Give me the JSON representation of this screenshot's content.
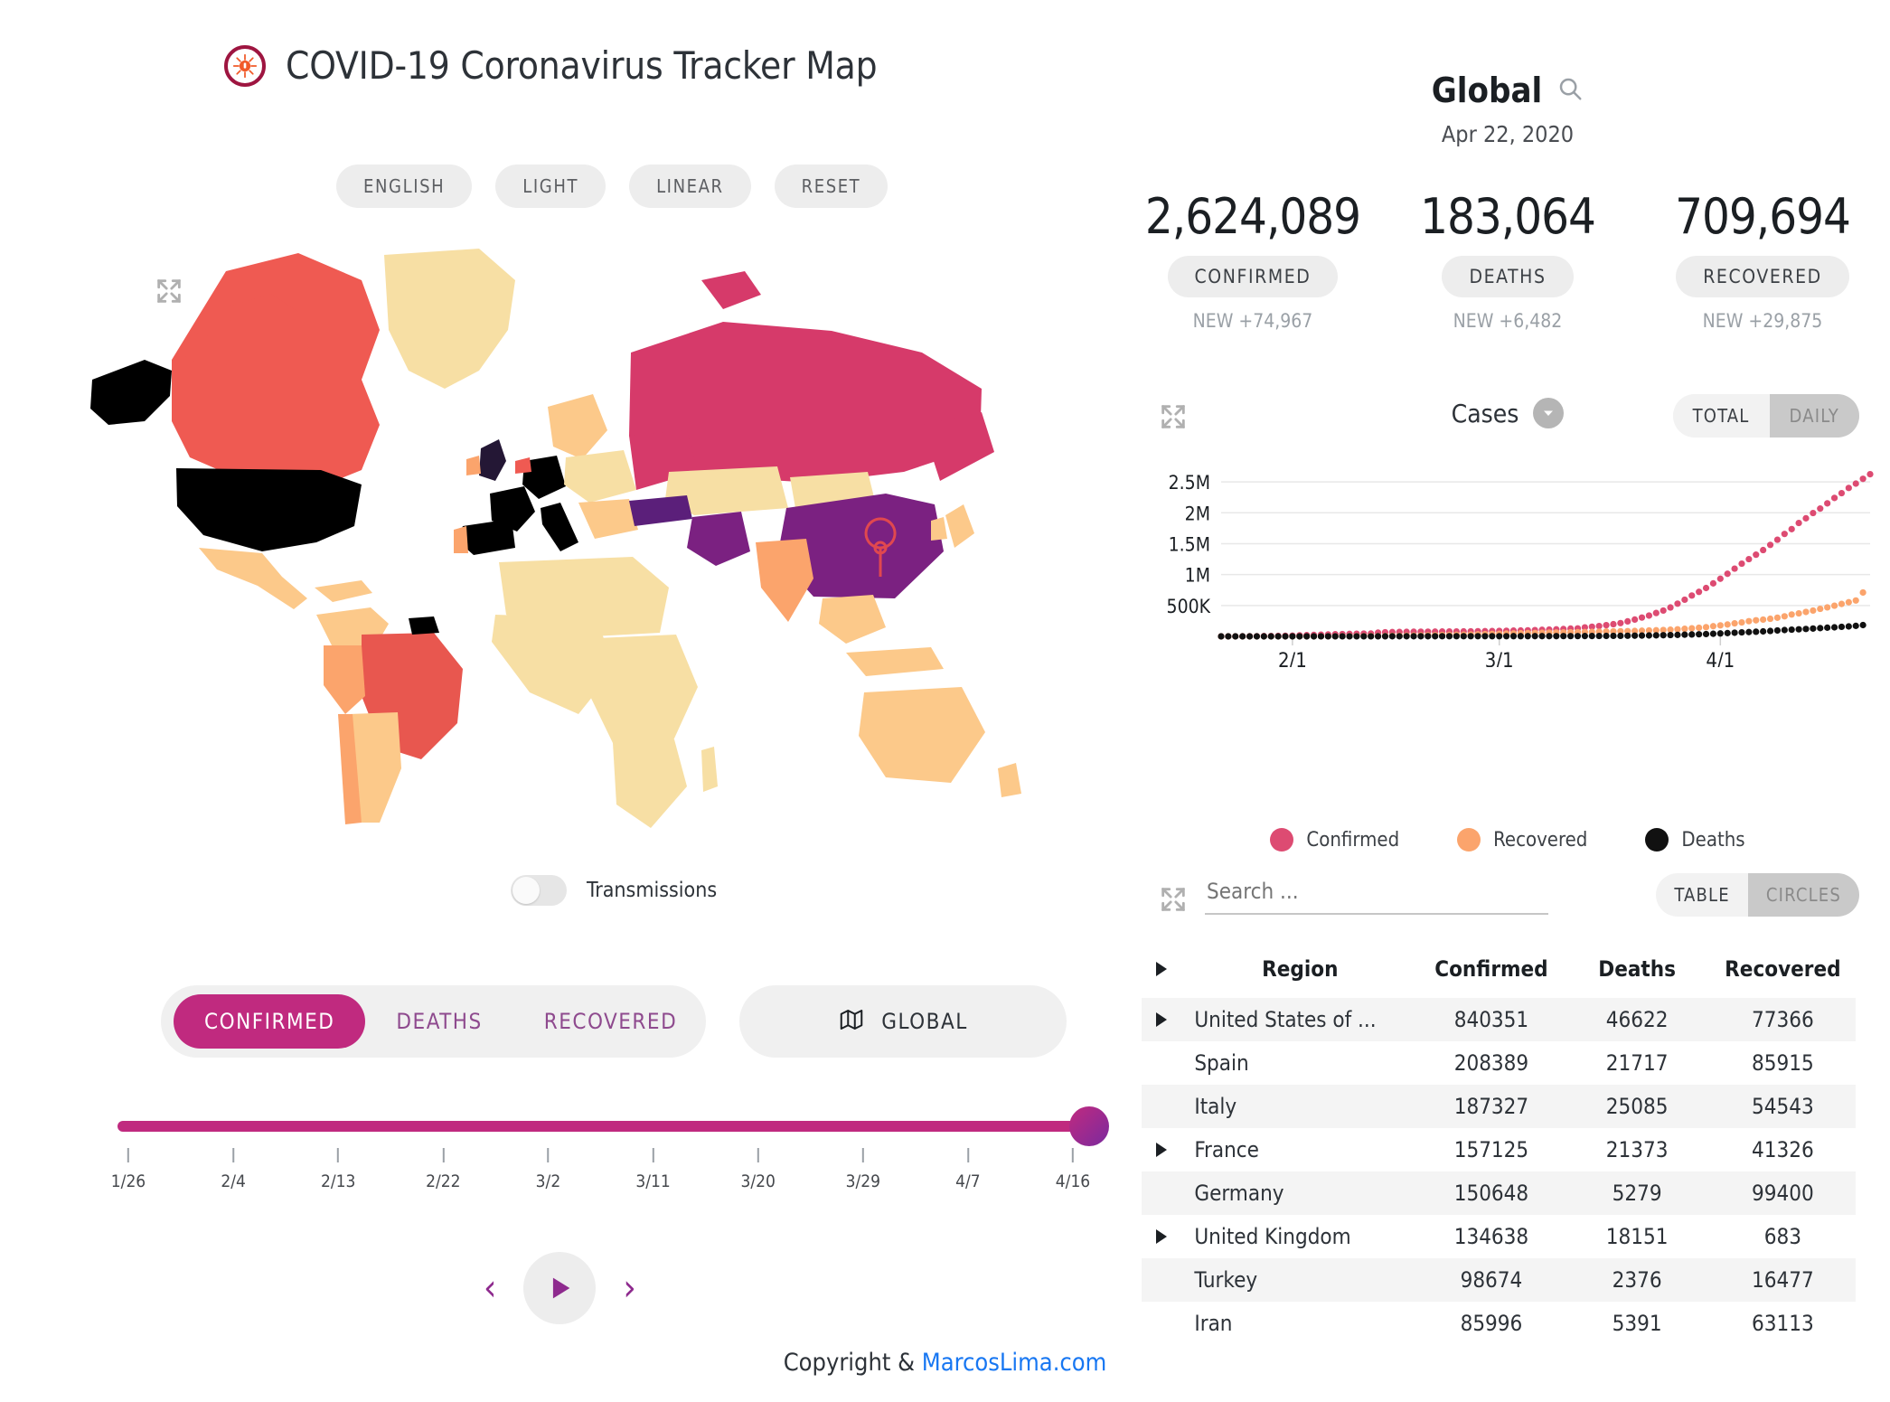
{
  "header": {
    "title": "COVID-19 Coronavirus Tracker Map",
    "logo_icon": "coronavirus-icon"
  },
  "map_options": [
    {
      "label": "ENGLISH"
    },
    {
      "label": "LIGHT"
    },
    {
      "label": "LINEAR"
    },
    {
      "label": "RESET"
    }
  ],
  "map": {
    "expand_icon": "expand-icon",
    "marker_icon": "location-pin-icon",
    "transmissions_label": "Transmissions",
    "transmissions_on": false,
    "colors": {
      "highest": "#000000",
      "crimson": "#d63a6a",
      "purple": "#7b2181",
      "red": "#ef5a52",
      "orange": "#fba46c",
      "light_orange": "#fcc98a",
      "pale": "#f7dfa4",
      "lightest": "#fae7b0"
    }
  },
  "metric_tabs": [
    {
      "label": "CONFIRMED",
      "active": true
    },
    {
      "label": "DEATHS",
      "active": false
    },
    {
      "label": "RECOVERED",
      "active": false
    }
  ],
  "scope_button": {
    "label": "GLOBAL",
    "icon": "map-icon"
  },
  "timeline": {
    "ticks": [
      "1/26",
      "2/4",
      "2/13",
      "2/22",
      "3/2",
      "3/11",
      "3/20",
      "3/29",
      "4/7",
      "4/16"
    ],
    "handle_position_pct": 100
  },
  "playback": {
    "prev_icon": "chevron-left-icon",
    "play_icon": "play-icon",
    "next_icon": "chevron-right-icon"
  },
  "footer": {
    "text": "Copyright & ",
    "link": "MarcosLima.com"
  },
  "panel": {
    "scope_title": "Global",
    "search_icon": "search-icon",
    "date": "Apr 22, 2020",
    "stats": [
      {
        "value": "2,624,089",
        "label": "CONFIRMED",
        "new": "NEW +74,967"
      },
      {
        "value": "183,064",
        "label": "DEATHS",
        "new": "NEW +6,482"
      },
      {
        "value": "709,694",
        "label": "RECOVERED",
        "new": "NEW +29,875"
      }
    ]
  },
  "chart_panel": {
    "expand_icon": "expand-icon",
    "selector_label": "Cases",
    "caret_icon": "chevron-down-icon",
    "mode_total": "TOTAL",
    "mode_daily": "DAILY",
    "active_mode": "TOTAL"
  },
  "table_panel": {
    "expand_icon": "expand-icon",
    "search_placeholder": "Search ...",
    "search_value": "",
    "view_table": "TABLE",
    "view_circles": "CIRCLES",
    "active_view": "TABLE",
    "columns": [
      "Region",
      "Confirmed",
      "Deaths",
      "Recovered"
    ],
    "rows": [
      {
        "expandable": true,
        "region": "United States of ...",
        "confirmed": "840351",
        "deaths": "46622",
        "recovered": "77366"
      },
      {
        "expandable": false,
        "region": "Spain",
        "confirmed": "208389",
        "deaths": "21717",
        "recovered": "85915"
      },
      {
        "expandable": false,
        "region": "Italy",
        "confirmed": "187327",
        "deaths": "25085",
        "recovered": "54543"
      },
      {
        "expandable": true,
        "region": "France",
        "confirmed": "157125",
        "deaths": "21373",
        "recovered": "41326"
      },
      {
        "expandable": false,
        "region": "Germany",
        "confirmed": "150648",
        "deaths": "5279",
        "recovered": "99400"
      },
      {
        "expandable": true,
        "region": "United Kingdom",
        "confirmed": "134638",
        "deaths": "18151",
        "recovered": "683"
      },
      {
        "expandable": false,
        "region": "Turkey",
        "confirmed": "98674",
        "deaths": "2376",
        "recovered": "16477"
      },
      {
        "expandable": false,
        "region": "Iran",
        "confirmed": "85996",
        "deaths": "5391",
        "recovered": "63113"
      }
    ]
  },
  "chart_data": {
    "type": "line",
    "title": "Cases",
    "xlabel": "",
    "ylabel": "",
    "x_ticks": [
      "2/1",
      "3/1",
      "4/1"
    ],
    "y_ticks": [
      "500K",
      "1M",
      "1.5M",
      "2M",
      "2.5M"
    ],
    "ylim": [
      0,
      2750000
    ],
    "grid": true,
    "legend_position": "bottom",
    "x_start": "1/22",
    "x_end": "4/22",
    "series": [
      {
        "name": "Confirmed",
        "color": "#dd4b72",
        "values": [
          555,
          654,
          941,
          1434,
          2118,
          2927,
          5578,
          6166,
          8234,
          9927,
          12038,
          16787,
          19881,
          23892,
          27635,
          30794,
          34391,
          37120,
          40150,
          42762,
          44802,
          45221,
          60368,
          66885,
          69030,
          71224,
          73258,
          75136,
          75639,
          76197,
          76819,
          78572,
          78958,
          79561,
          80406,
          81388,
          82746,
          84112,
          86011,
          88369,
          90306,
          92840,
          95120,
          97886,
          101801,
          105847,
          109821,
          113590,
          118620,
          125875,
          128352,
          145205,
          156101,
          167454,
          181574,
          197102,
          214910,
          242708,
          272166,
          304524,
          336953,
          378235,
          418045,
          467594,
          529591,
          593291,
          660706,
          720117,
          782365,
          857487,
          932605,
          1013157,
          1095917,
          1176493,
          1249754,
          1321464,
          1396475,
          1480202,
          1564428,
          1657526,
          1735650,
          1834721,
          1910681,
          1995851,
          2068120,
          2152437,
          2240191,
          2317758,
          2401379,
          2472258,
          2549123,
          2624089
        ],
        "marker": "circle"
      },
      {
        "name": "Recovered",
        "color": "#fba46c",
        "values": [
          28,
          30,
          36,
          39,
          52,
          61,
          107,
          126,
          143,
          222,
          284,
          472,
          623,
          852,
          1124,
          1487,
          2011,
          2616,
          3244,
          3946,
          4683,
          5150,
          6295,
          8058,
          9395,
          10865,
          12583,
          14352,
          16121,
          18177,
          18890,
          22886,
          23394,
          25227,
          27905,
          30384,
          33277,
          36711,
          39782,
          42716,
          45602,
          48228,
          51170,
          53796,
          55865,
          58358,
          60694,
          62494,
          64404,
          67003,
          68324,
          70251,
          72624,
          76034,
          78088,
          80840,
          83312,
          84962,
          87403,
          91499,
          95923,
          98334,
          102844,
          107984,
          113787,
          122150,
          130915,
          139415,
          148824,
          164566,
          178034,
          191853,
          210263,
          225796,
          246152,
          260012,
          271872,
          284802,
          302126,
          324327,
          353975,
          372109,
          395247,
          417891,
          445045,
          469305,
          496260,
          524855,
          552407,
          580840,
          709694
        ],
        "marker": "circle"
      },
      {
        "name": "Deaths",
        "color": "#111111",
        "values": [
          17,
          18,
          26,
          42,
          56,
          82,
          131,
          133,
          171,
          213,
          259,
          362,
          426,
          492,
          564,
          634,
          719,
          806,
          906,
          1013,
          1113,
          1118,
          1371,
          1523,
          1666,
          1770,
          1868,
          2007,
          2122,
          2247,
          2251,
          2458,
          2469,
          2629,
          2708,
          2770,
          2814,
          2872,
          2941,
          2996,
          3085,
          3160,
          3254,
          3348,
          3460,
          3558,
          3802,
          3988,
          4262,
          4615,
          4720,
          5404,
          5819,
          6440,
          7126,
          7905,
          8733,
          9867,
          11299,
          12973,
          14652,
          16514,
          18615,
          21181,
          23970,
          27198,
          30652,
          33925,
          37582,
          42107,
          47180,
          52983,
          58787,
          64606,
          69374,
          74565,
          80304,
          87320,
          95455,
          102525,
          108503,
          114091,
          119482,
          126611,
          133521,
          140773,
          146088,
          154256,
          160721,
          169985,
          183064
        ],
        "marker": "circle"
      }
    ]
  }
}
